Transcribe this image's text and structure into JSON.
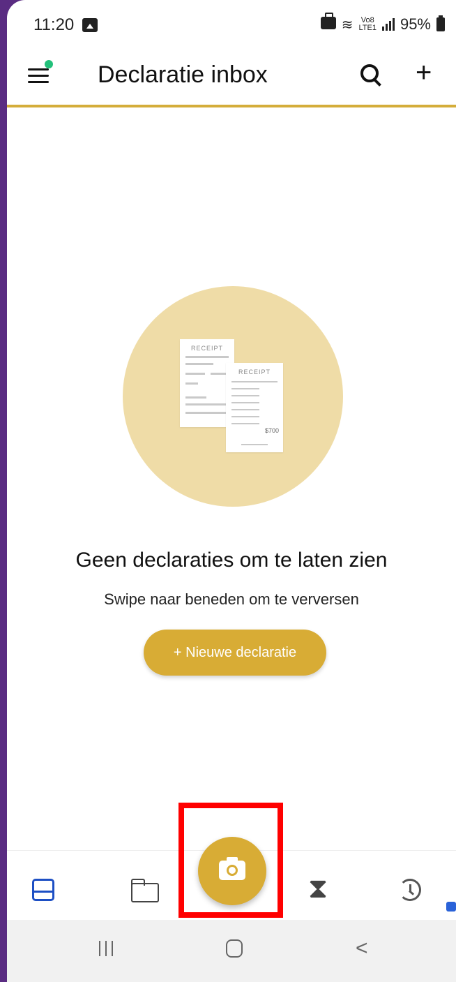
{
  "status_bar": {
    "time": "11:20",
    "network_top": "Vo8",
    "network_bottom": "LTE1",
    "battery": "95%"
  },
  "app_bar": {
    "title": "Declaratie inbox",
    "add_glyph": "+"
  },
  "illustration": {
    "receipt_label_1": "RECEIPT",
    "receipt_label_2": "RECEIPT",
    "amount": "$700"
  },
  "empty_state": {
    "title": "Geen declaraties om te laten zien",
    "subtitle": "Swipe naar beneden om te verversen",
    "button_label": "+ Nieuwe declaratie"
  },
  "bottom_nav": {
    "items": [
      "inbox-icon",
      "folder-icon",
      "camera-icon",
      "hourglass-icon",
      "history-icon"
    ],
    "hourglass_glyph": "⧗"
  },
  "system_nav": {
    "back_glyph": "<"
  },
  "colors": {
    "accent": "#d8ac35",
    "active_icon": "#1d4fc4",
    "highlight": "#ff0000",
    "illustration_bg": "#efdca7"
  }
}
